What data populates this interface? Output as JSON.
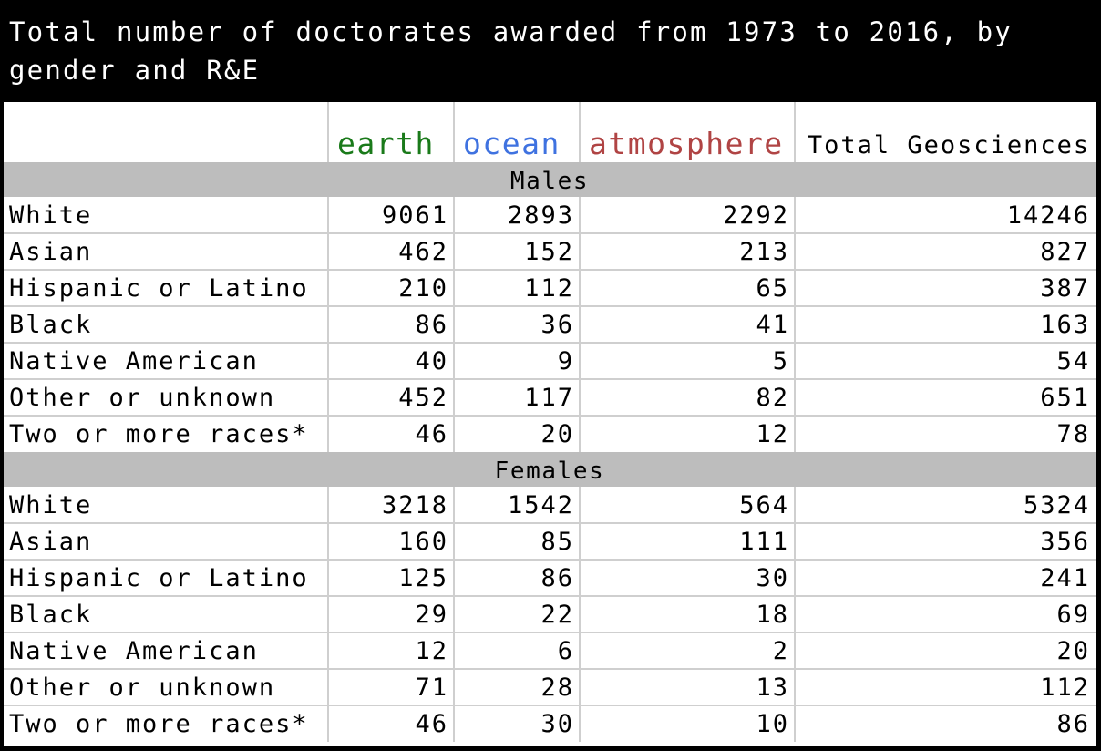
{
  "chart_data": {
    "type": "table",
    "title": "Total number of doctorates awarded from 1973 to 2016, by gender and R&E",
    "columns": [
      {
        "label": "earth",
        "color": "#1a7a1a"
      },
      {
        "label": "ocean",
        "color": "#3f72e0"
      },
      {
        "label": "atmosphere",
        "color": "#b04444"
      },
      {
        "label": "Total Geosciences",
        "color": "#000000"
      }
    ],
    "groups": [
      {
        "name": "Males",
        "rows": [
          {
            "label": "White",
            "values": [
              9061,
              2893,
              2292,
              14246
            ]
          },
          {
            "label": "Asian",
            "values": [
              462,
              152,
              213,
              827
            ]
          },
          {
            "label": "Hispanic or Latino",
            "values": [
              210,
              112,
              65,
              387
            ]
          },
          {
            "label": "Black",
            "values": [
              86,
              36,
              41,
              163
            ]
          },
          {
            "label": "Native American",
            "values": [
              40,
              9,
              5,
              54
            ]
          },
          {
            "label": "Other or unknown",
            "values": [
              452,
              117,
              82,
              651
            ]
          },
          {
            "label": "Two or more races*",
            "values": [
              46,
              20,
              12,
              78
            ]
          }
        ]
      },
      {
        "name": "Females",
        "rows": [
          {
            "label": "White",
            "values": [
              3218,
              1542,
              564,
              5324
            ]
          },
          {
            "label": "Asian",
            "values": [
              160,
              85,
              111,
              356
            ]
          },
          {
            "label": "Hispanic or Latino",
            "values": [
              125,
              86,
              30,
              241
            ]
          },
          {
            "label": "Black",
            "values": [
              29,
              22,
              18,
              69
            ]
          },
          {
            "label": "Native American",
            "values": [
              12,
              6,
              2,
              20
            ]
          },
          {
            "label": "Other or unknown",
            "values": [
              71,
              28,
              13,
              112
            ]
          },
          {
            "label": "Two or more races*",
            "values": [
              46,
              30,
              10,
              86
            ]
          }
        ]
      }
    ]
  }
}
